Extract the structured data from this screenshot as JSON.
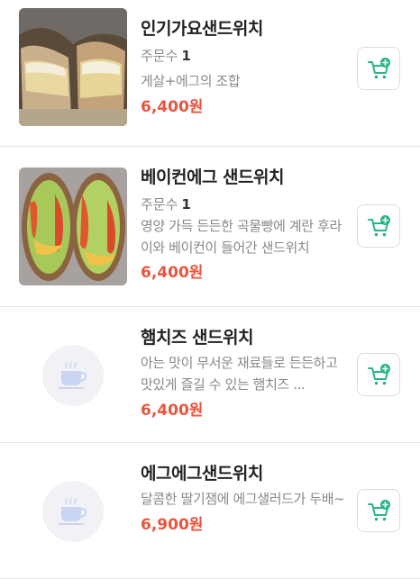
{
  "items": [
    {
      "name": "인기가요샌드위치",
      "orders_label": "주문수",
      "orders_count": "1",
      "desc": "게살+에그의 조합",
      "price": "6,400원",
      "image": "photo"
    },
    {
      "name": "베이컨에그 샌드위치",
      "orders_label": "주문수",
      "orders_count": "1",
      "desc": "영양 가득 든든한 곡물빵에 계란 후라이와 베이컨이 들어간 샌드위치",
      "price": "6,400원",
      "image": "photo"
    },
    {
      "name": "햄치즈 샌드위치",
      "desc": "아는 맛이 무서운 재료들로 든든하고 맛있게 즐길 수 있는 햄치즈 ...",
      "price": "6,400원",
      "image": "placeholder-cup-icon"
    },
    {
      "name": "에그에그샌드위치",
      "desc": "달콤한 딸기잼에 에그샐러드가 두배~",
      "price": "6,900원",
      "image": "placeholder-cup-icon"
    }
  ],
  "icons": {
    "cart": "cart-plus-icon",
    "placeholder": "coffee-cup-icon"
  },
  "colors": {
    "price": "#e8553e",
    "cart_icon": "#2bb38a",
    "placeholder_cup": "#c9d3f2"
  }
}
